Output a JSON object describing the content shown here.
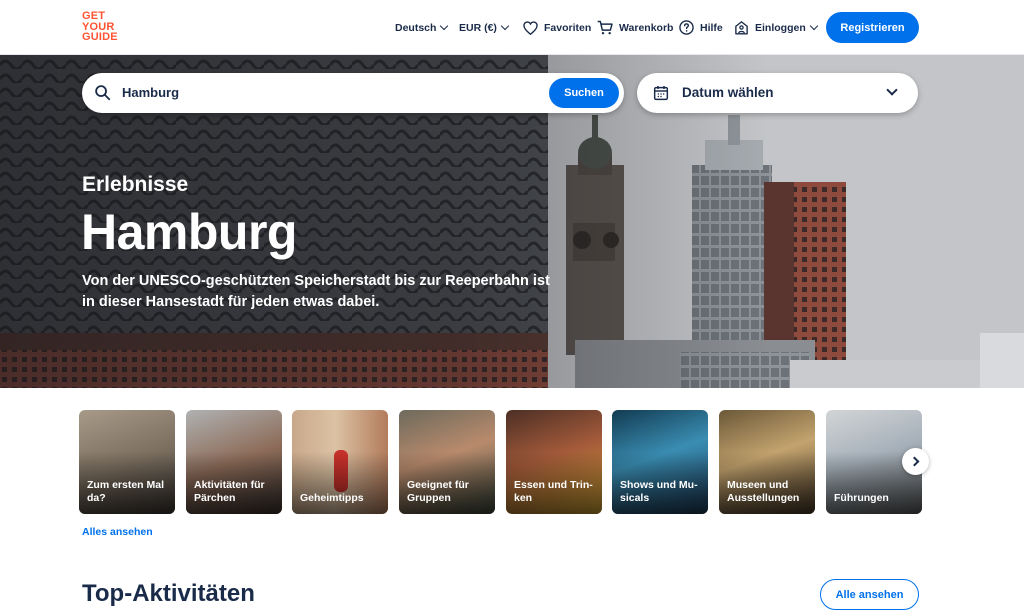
{
  "header": {
    "logo_lines": [
      "GET",
      "YOUR",
      "GUIDE"
    ],
    "language": "Deutsch",
    "currency": "EUR (€)",
    "favorites": "Favoriten",
    "cart": "Warenkorb",
    "help": "Hilfe",
    "login": "Einloggen",
    "register": "Registrieren"
  },
  "search": {
    "value": "Hamburg",
    "button": "Suchen",
    "date_placeholder": "Datum wählen"
  },
  "hero": {
    "eyebrow": "Erlebnisse",
    "title": "Hamburg",
    "subtitle": "Von der UNESCO-geschützten Speicherstadt bis zur Reeperbahn ist in dieser Hansestadt für jeden etwas dabei."
  },
  "categories": [
    {
      "label": "Zum ersten Mal da?"
    },
    {
      "label": "Aktivitäten für Pärchen"
    },
    {
      "label": "Geheimtipps"
    },
    {
      "label": "Geeignet für Gruppen"
    },
    {
      "label": "Essen und Trin-ken"
    },
    {
      "label": "Shows und Mu-sicals"
    },
    {
      "label": "Museen und Ausstellungen"
    },
    {
      "label": "Führungen"
    }
  ],
  "see_all_categories": "Alles ansehen",
  "top_activities": {
    "title": "Top-Aktivitäten",
    "button": "Alle ansehen"
  },
  "colors": {
    "brand": "#ff5533",
    "primary": "#0071eb",
    "text": "#1a2b49"
  }
}
